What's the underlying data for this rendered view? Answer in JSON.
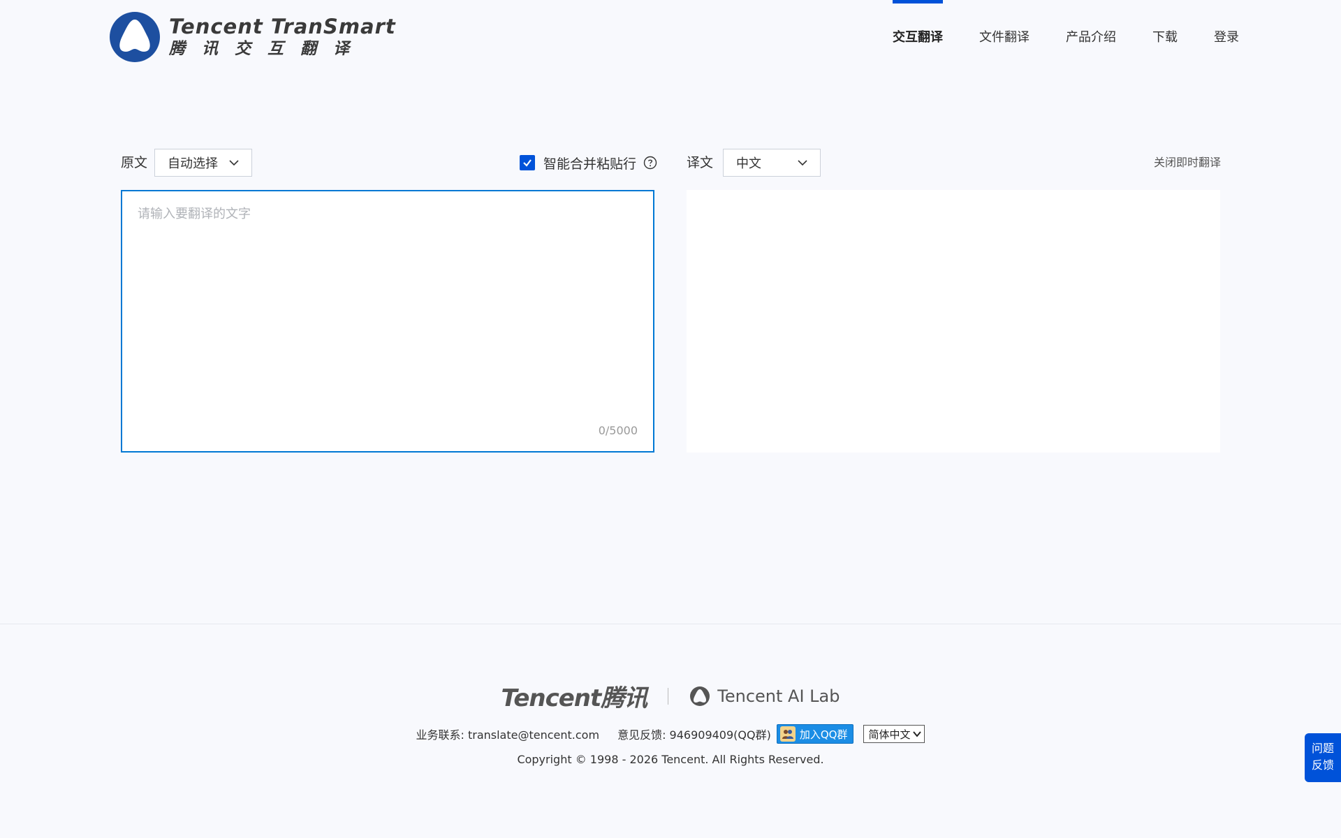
{
  "header": {
    "logo_en": "Tencent TranSmart",
    "logo_cn": "腾讯交互翻译",
    "nav": [
      {
        "label": "交互翻译",
        "active": true
      },
      {
        "label": "文件翻译",
        "active": false
      },
      {
        "label": "产品介绍",
        "active": false
      },
      {
        "label": "下载",
        "active": false
      },
      {
        "label": "登录",
        "active": false
      }
    ]
  },
  "source": {
    "label": "原文",
    "language": "自动选择",
    "merge_label": "智能合并粘贴行",
    "merge_checked": true,
    "placeholder": "请输入要翻译的文字",
    "text": "",
    "counter": "0/5000"
  },
  "target": {
    "label": "译文",
    "language": "中文",
    "close_instant": "关闭即时翻译",
    "text": ""
  },
  "footer": {
    "tencent_logo": "Tencent腾讯",
    "ailab": "Tencent AI Lab",
    "business_contact": "业务联系: translate@tencent.com",
    "feedback_contact": "意见反馈: 946909409(QQ群)",
    "qq_button": "加入QQ群",
    "language_select": "简体中文",
    "copyright": "Copyright © 1998 - 2026 Tencent. All Rights Reserved."
  },
  "feedback_button": {
    "line1": "问题",
    "line2": "反馈"
  },
  "colors": {
    "brand": "#0052d9",
    "input_border": "#0078d4",
    "background": "#f8f9fd"
  }
}
